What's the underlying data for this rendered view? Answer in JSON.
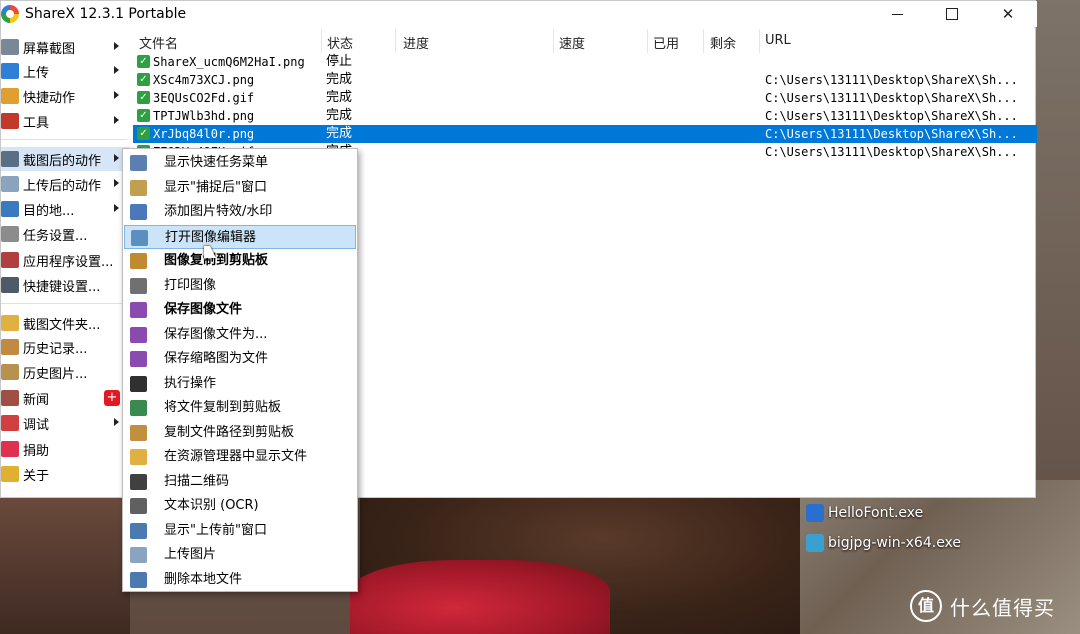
{
  "window": {
    "title": "ShareX 12.3.1 Portable"
  },
  "main_menu": [
    {
      "label": "屏幕截图",
      "icon": "camera-icon",
      "color": "#7a8796",
      "arrow": true
    },
    {
      "label": "上传",
      "icon": "upload-arrow-icon",
      "color": "#2f7fd8",
      "arrow": true
    },
    {
      "label": "快捷动作",
      "icon": "grid-icon",
      "color": "#e0a030",
      "arrow": true
    },
    {
      "label": "工具",
      "icon": "toolbox-icon",
      "color": "#c0392b",
      "arrow": true
    },
    {
      "label": "截图后的动作",
      "icon": "image-settings-icon",
      "color": "#5a6f86",
      "arrow": true,
      "active": true
    },
    {
      "label": "上传后的动作",
      "icon": "cloud-icon",
      "color": "#8aa4c0",
      "arrow": true
    },
    {
      "label": "目的地...",
      "icon": "globe-user-icon",
      "color": "#3a7bbf",
      "arrow": true
    },
    {
      "label": "任务设置...",
      "icon": "gear-icon",
      "color": "#8c8c8c",
      "arrow": false
    },
    {
      "label": "应用程序设置...",
      "icon": "tools-icon",
      "color": "#b04040",
      "arrow": false
    },
    {
      "label": "快捷键设置...",
      "icon": "keyboard-icon",
      "color": "#505a66",
      "arrow": false
    },
    {
      "label": "截图文件夹...",
      "icon": "folder-icon",
      "color": "#e0b040",
      "arrow": false
    },
    {
      "label": "历史记录...",
      "icon": "history-icon",
      "color": "#c08a40",
      "arrow": false
    },
    {
      "label": "历史图片...",
      "icon": "image-history-icon",
      "color": "#b89050",
      "arrow": false
    },
    {
      "label": "新闻",
      "icon": "megaphone-icon",
      "color": "#a05040",
      "arrow": false
    },
    {
      "label": "调试",
      "icon": "warning-icon",
      "color": "#d04040",
      "arrow": true
    },
    {
      "label": "捐助",
      "icon": "heart-icon",
      "color": "#e03050",
      "arrow": false
    },
    {
      "label": "关于",
      "icon": "crown-icon",
      "color": "#e0b030",
      "arrow": false
    }
  ],
  "news_badge": "+",
  "list": {
    "headers": [
      "文件名",
      "状态",
      "进度",
      "速度",
      "已用",
      "剩余",
      "URL"
    ],
    "rows": [
      {
        "name": "ShareX_ucmQ6M2HaI.png",
        "status": "停止",
        "url": ""
      },
      {
        "name": "XSc4m73XCJ.png",
        "status": "完成",
        "url": "C:\\Users\\13111\\Desktop\\ShareX\\Sh..."
      },
      {
        "name": "3EQUsCO2Fd.gif",
        "status": "完成",
        "url": "C:\\Users\\13111\\Desktop\\ShareX\\Sh..."
      },
      {
        "name": "TPTJWlb3hd.png",
        "status": "完成",
        "url": "C:\\Users\\13111\\Desktop\\ShareX\\Sh..."
      },
      {
        "name": "XrJbq84l0r.png",
        "status": "完成",
        "url": "C:\\Users\\13111\\Desktop\\ShareX\\Sh...",
        "selected": true
      },
      {
        "name": "ZEODV-49EU.gif",
        "status": "完成",
        "url": "C:\\Users\\13111\\Desktop\\ShareX\\Sh..."
      }
    ]
  },
  "submenu": [
    {
      "label": "显示快速任务菜单",
      "icon": "menu-list-icon",
      "color": "#5a7fb0",
      "bold": false
    },
    {
      "label": "显示\"捕捉后\"窗口",
      "icon": "window-icon",
      "color": "#c0a050",
      "bold": false
    },
    {
      "label": "添加图片特效/水印",
      "icon": "image-effects-icon",
      "color": "#4a78b8",
      "bold": false
    },
    {
      "label": "打开图像编辑器",
      "icon": "image-editor-icon",
      "color": "#5a8fc0",
      "bold": false,
      "hover": true
    },
    {
      "label": "图像复制到剪贴板",
      "icon": "clipboard-image-icon",
      "color": "#c08a30",
      "bold": true
    },
    {
      "label": "打印图像",
      "icon": "printer-icon",
      "color": "#707070",
      "bold": false
    },
    {
      "label": "保存图像文件",
      "icon": "save-icon",
      "color": "#8a4ab0",
      "bold": true
    },
    {
      "label": "保存图像文件为...",
      "icon": "save-as-icon",
      "color": "#8a4ab0",
      "bold": false
    },
    {
      "label": "保存缩略图为文件",
      "icon": "save-thumbnail-icon",
      "color": "#8a4ab0",
      "bold": false
    },
    {
      "label": "执行操作",
      "icon": "terminal-icon",
      "color": "#303030",
      "bold": false
    },
    {
      "label": "将文件复制到剪贴板",
      "icon": "copy-file-icon",
      "color": "#3a8a50",
      "bold": false
    },
    {
      "label": "复制文件路径到剪贴板",
      "icon": "clipboard-path-icon",
      "color": "#c09040",
      "bold": false
    },
    {
      "label": "在资源管理器中显示文件",
      "icon": "folder-open-icon",
      "color": "#e0b040",
      "bold": false
    },
    {
      "label": "扫描二维码",
      "icon": "qr-code-icon",
      "color": "#404040",
      "bold": false
    },
    {
      "label": "文本识别 (OCR)",
      "icon": "ocr-text-icon",
      "color": "#606060",
      "bold": false
    },
    {
      "label": "显示\"上传前\"窗口",
      "icon": "upload-window-icon",
      "color": "#4a7ab0",
      "bold": false
    },
    {
      "label": "上传图片",
      "icon": "cloud-upload-icon",
      "color": "#8aa4c0",
      "bold": false
    },
    {
      "label": "删除本地文件",
      "icon": "delete-file-icon",
      "color": "#4a7ab0",
      "bold": false
    }
  ],
  "desktop_icons": [
    {
      "label": "HelloFont.exe",
      "icon": "hellofont-app-icon",
      "color": "#2a6fd0"
    },
    {
      "label": "bigjpg-win-x64.exe",
      "icon": "bigjpg-app-icon",
      "color": "#3aa0d0"
    }
  ],
  "watermark": {
    "logo": "值",
    "text": "什么值得买"
  }
}
